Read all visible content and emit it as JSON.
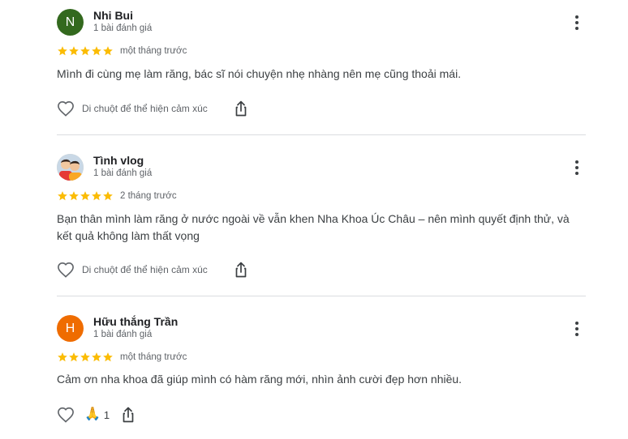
{
  "reviews": [
    {
      "author": "Nhi Bui",
      "initial": "N",
      "avatar_color": "#33691e",
      "review_count": "1 bài đánh giá",
      "stars": 5,
      "time": "một tháng trước",
      "text": "Mình đi cùng mẹ làm răng, bác sĩ nói chuyện nhẹ nhàng nên mẹ cũng thoải mái.",
      "react_hint": "Di chuột để thể hiện cảm xúc"
    },
    {
      "author": "Tình vlog",
      "review_count": "1 bài đánh giá",
      "stars": 5,
      "time": "2 tháng trước",
      "text": "Bạn thân mình làm răng ở nước ngoài về vẫn khen Nha Khoa Úc Châu – nên mình quyết định thử, và kết quả không làm thất vọng",
      "react_hint": "Di chuột để thể hiện cảm xúc"
    },
    {
      "author": "Hữu thắng Trần",
      "initial": "H",
      "avatar_color": "#ef6c00",
      "review_count": "1 bài đánh giá",
      "stars": 5,
      "time": "một tháng trước",
      "text": "Cảm ơn nha khoa đã giúp mình có hàm răng mới, nhìn ảnh cười đẹp hơn nhiều.",
      "reaction_emoji": "🙏",
      "reaction_count": "1"
    }
  ],
  "colors": {
    "star": "#fbbc04",
    "icon": "#5f6368"
  },
  "icons": {
    "like": "heart-outline-icon",
    "share": "share-icon",
    "more": "more-vert-icon"
  }
}
